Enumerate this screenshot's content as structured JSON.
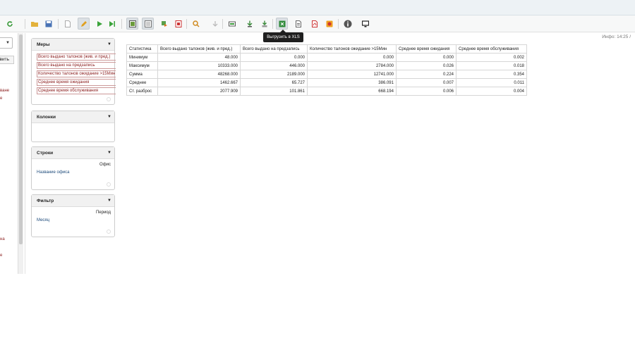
{
  "toolbar": {
    "tooltip": "Выгрузить в XLS",
    "info_label": "Инфо:",
    "time": "14:25",
    "info_suffix": "/"
  },
  "left": {
    "button_label": "вить",
    "link1": "ване",
    "link2": "е",
    "link3": "на",
    "link4": "е"
  },
  "panels": {
    "measures": {
      "title": "Меры",
      "items": [
        "Всего выдано талонов (жив. и пред.)",
        "Всего выдано на предзапись",
        "Количество талонов ожидание >15Мин",
        "Среднее время ожидания",
        "Среднее время обслуживания"
      ]
    },
    "columns": {
      "title": "Колонки"
    },
    "rows": {
      "title": "Строки",
      "label": "Офис",
      "item": "Название офиса"
    },
    "filter": {
      "title": "Фильтр",
      "label": "Период",
      "item": "Месяц"
    }
  },
  "table": {
    "headers": [
      "Статистика",
      "Всего выдано талонов (жив. и пред.)",
      "Всего выдано на предзапись",
      "Количество талонов ожидание >15Мин",
      "Среднее время ожидания",
      "Среднее время обслуживания"
    ],
    "rows": [
      [
        "Минимум",
        "48.000",
        "0.000",
        "0.000",
        "0.000",
        "0.002"
      ],
      [
        "Максимум",
        "10333.000",
        "446.000",
        "2784.000",
        "0.026",
        "0.018"
      ],
      [
        "Сумма",
        "48268.000",
        "2189.000",
        "12741.000",
        "0.224",
        "0.354"
      ],
      [
        "Среднее",
        "1462.667",
        "65.727",
        "386.091",
        "0.007",
        "0.011"
      ],
      [
        "Ст. разброс",
        "2077.909",
        "101.861",
        "668.194",
        "0.006",
        "0.004"
      ]
    ]
  },
  "colors": {
    "accent_red": "#8b1d1d",
    "link_blue": "#1c4a7a"
  }
}
